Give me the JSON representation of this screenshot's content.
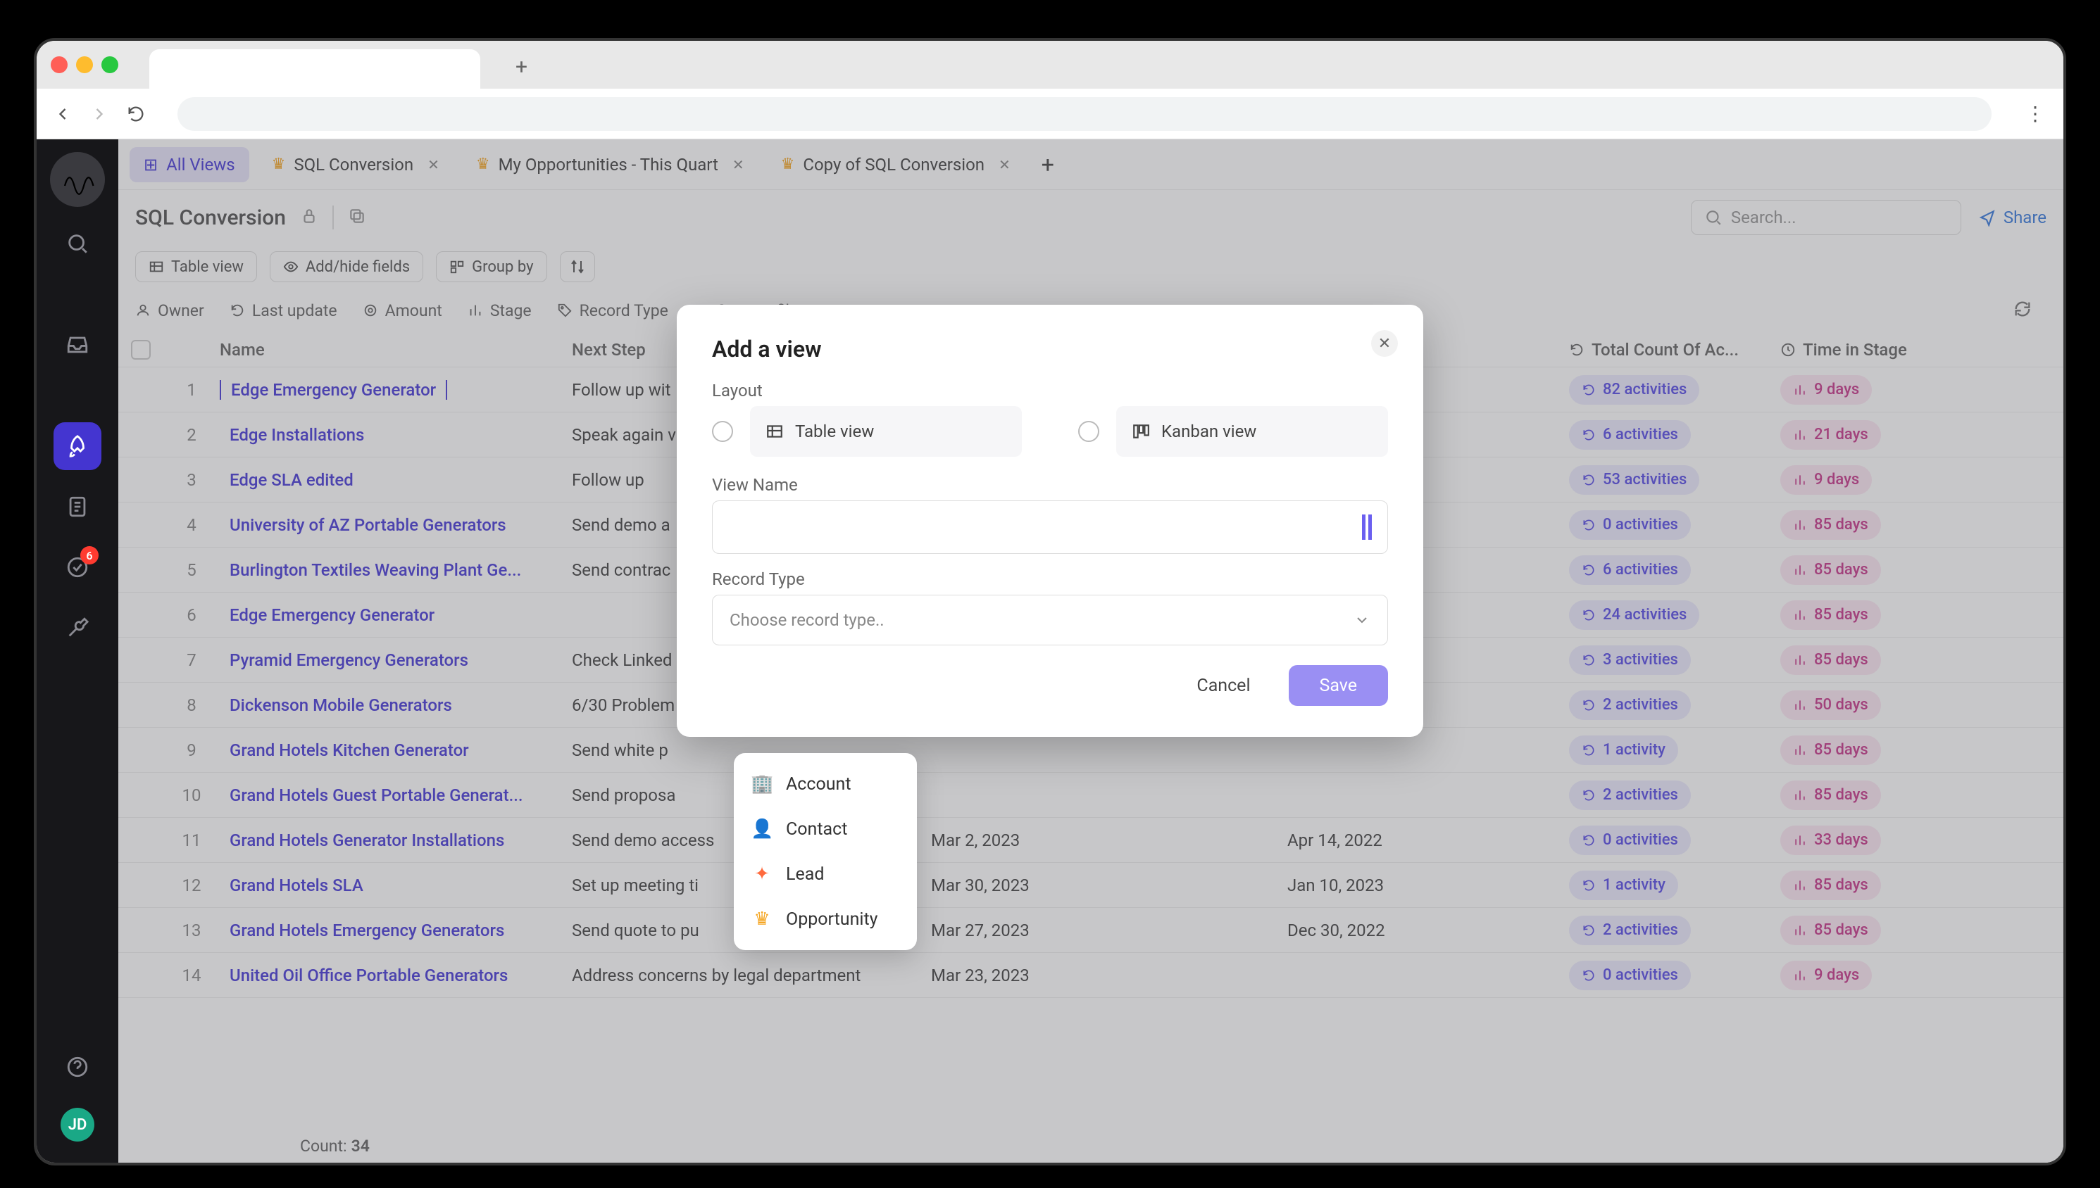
{
  "sidebar": {
    "badge_count": "6",
    "avatar_initials": "JD"
  },
  "tabs": {
    "all_views": "All Views",
    "items": [
      {
        "label": "SQL Conversion"
      },
      {
        "label": "My Opportunities - This Quart"
      },
      {
        "label": "Copy of SQL Conversion"
      }
    ]
  },
  "page": {
    "title": "SQL Conversion",
    "search_placeholder": "Search...",
    "share": "Share"
  },
  "toolbar": {
    "table_view": "Table view",
    "add_hide": "Add/hide fields",
    "group_by": "Group by"
  },
  "filters": {
    "owner": "Owner",
    "last_update": "Last update",
    "amount": "Amount",
    "stage": "Stage",
    "record_type": "Record Type",
    "custom": "Custom filters"
  },
  "columns": {
    "name": "Name",
    "next_step": "Next Step",
    "date1": "",
    "date2": "",
    "activities": "Total Count Of Ac...",
    "time": "Time in Stage"
  },
  "rows": [
    {
      "n": "1",
      "name": "Edge Emergency Generator",
      "next": "Follow up wit",
      "d1": "",
      "d2": "",
      "act": "82 activities",
      "time": "9 days",
      "selected": true
    },
    {
      "n": "2",
      "name": "Edge Installations",
      "next": "Speak again v",
      "d1": "",
      "d2": "",
      "act": "6 activities",
      "time": "21 days"
    },
    {
      "n": "3",
      "name": "Edge SLA edited",
      "next": "Follow up",
      "d1": "",
      "d2": "",
      "act": "53 activities",
      "time": "9 days"
    },
    {
      "n": "4",
      "name": "University of AZ Portable Generators",
      "next": "Send demo a",
      "d1": "",
      "d2": "",
      "act": "0 activities",
      "time": "85 days"
    },
    {
      "n": "5",
      "name": "Burlington Textiles Weaving Plant Ge...",
      "next": "Send contrac",
      "d1": "",
      "d2": "",
      "act": "6 activities",
      "time": "85 days"
    },
    {
      "n": "6",
      "name": "Edge Emergency Generator",
      "next": "",
      "d1": "",
      "d2": "",
      "act": "24 activities",
      "time": "85 days"
    },
    {
      "n": "7",
      "name": "Pyramid Emergency Generators",
      "next": "Check Linked",
      "d1": "",
      "d2": "",
      "act": "3 activities",
      "time": "85 days"
    },
    {
      "n": "8",
      "name": "Dickenson Mobile Generators",
      "next": "6/30 Problem",
      "d1": "",
      "d2": "",
      "act": "2 activities",
      "time": "50 days"
    },
    {
      "n": "9",
      "name": "Grand Hotels Kitchen Generator",
      "next": "Send white p",
      "d1": "",
      "d2": "",
      "act": "1 activity",
      "time": "85 days"
    },
    {
      "n": "10",
      "name": "Grand Hotels Guest Portable Generat...",
      "next": "Send proposa",
      "d1": "",
      "d2": "",
      "act": "2 activities",
      "time": "85 days"
    },
    {
      "n": "11",
      "name": "Grand Hotels Generator Installations",
      "next": "Send demo access",
      "d1": "Mar 2, 2023",
      "d2": "Apr 14, 2022",
      "act": "0 activities",
      "time": "33 days"
    },
    {
      "n": "12",
      "name": "Grand Hotels SLA",
      "next": "Set up meeting ti",
      "d1": "Mar 30, 2023",
      "d2": "Jan 10, 2023",
      "act": "1 activity",
      "time": "85 days"
    },
    {
      "n": "13",
      "name": "Grand Hotels Emergency Generators",
      "next": "Send quote to pu",
      "d1": "Mar 27, 2023",
      "d2": "Dec 30, 2022",
      "act": "2 activities",
      "time": "85 days"
    },
    {
      "n": "14",
      "name": "United Oil Office Portable Generators",
      "next": "Address concerns by legal department",
      "d1": "Mar 23, 2023",
      "d2": "",
      "act": "0 activities",
      "time": "9 days"
    }
  ],
  "count": {
    "label": "Count:",
    "value": "34"
  },
  "modal": {
    "title": "Add a view",
    "layout_label": "Layout",
    "table_view": "Table view",
    "kanban_view": "Kanban view",
    "view_name_label": "View Name",
    "record_type_label": "Record Type",
    "record_type_placeholder": "Choose record type..",
    "cancel": "Cancel",
    "save": "Save"
  },
  "dropdown": {
    "account": "Account",
    "contact": "Contact",
    "lead": "Lead",
    "opportunity": "Opportunity"
  }
}
